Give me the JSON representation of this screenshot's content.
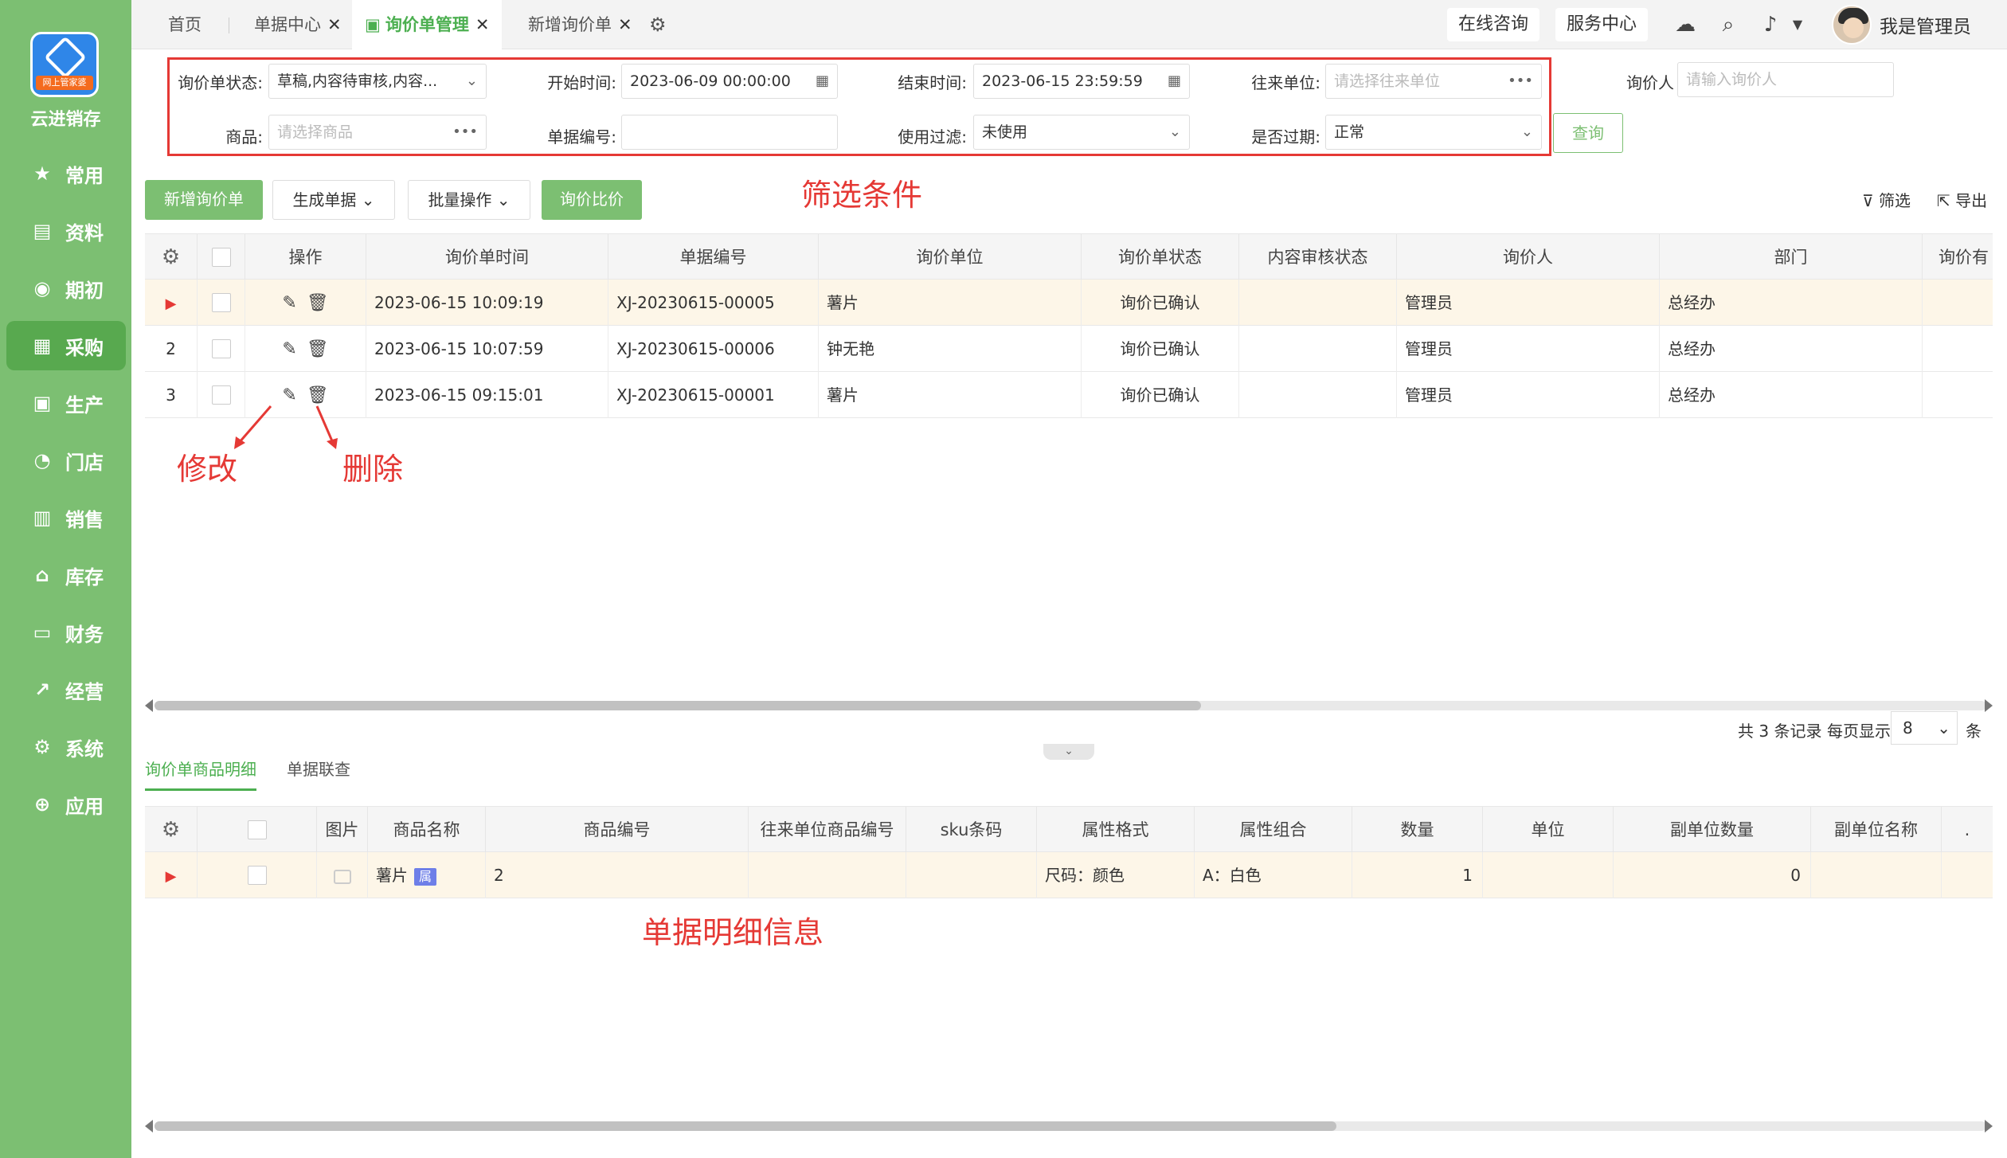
{
  "brand": {
    "name": "云进销存",
    "logo_band": "网上管家婆"
  },
  "sidebar": {
    "items": [
      {
        "label": "常用",
        "icon": "star-icon"
      },
      {
        "label": "资料",
        "icon": "doc-icon"
      },
      {
        "label": "期初",
        "icon": "target-icon"
      },
      {
        "label": "采购",
        "icon": "cart-icon",
        "active": true
      },
      {
        "label": "生产",
        "icon": "factory-icon"
      },
      {
        "label": "门店",
        "icon": "store-icon"
      },
      {
        "label": "销售",
        "icon": "chart-icon"
      },
      {
        "label": "库存",
        "icon": "warehouse-icon"
      },
      {
        "label": "财务",
        "icon": "wallet-icon"
      },
      {
        "label": "经营",
        "icon": "trend-icon"
      },
      {
        "label": "系统",
        "icon": "gear-icon"
      },
      {
        "label": "应用",
        "icon": "plus-icon"
      }
    ]
  },
  "tabs": [
    {
      "label": "首页"
    },
    {
      "label": "单据中心"
    },
    {
      "label": "询价单管理",
      "active": true
    },
    {
      "label": "新增询价单"
    }
  ],
  "header": {
    "online": "在线咨询",
    "service": "服务中心",
    "user": "我是管理员"
  },
  "filters": {
    "status_label": "询价单状态:",
    "status_value": "草稿,内容待审核,内容...",
    "start_label": "开始时间:",
    "start_value": "2023-06-09 00:00:00",
    "end_label": "结束时间:",
    "end_value": "2023-06-15 23:59:59",
    "partner_label": "往来单位:",
    "partner_placeholder": "请选择往来单位",
    "inquirer_label": "询价人",
    "inquirer_placeholder": "请输入询价人",
    "goods_label": "商品:",
    "goods_placeholder": "请选择商品",
    "docno_label": "单据编号:",
    "docno_value": "",
    "usefilter_label": "使用过滤:",
    "usefilter_value": "未使用",
    "expired_label": "是否过期:",
    "expired_value": "正常",
    "query_button": "查询"
  },
  "annotations": {
    "filter": "筛选条件",
    "edit": "修改",
    "delete": "删除",
    "detail": "单据明细信息"
  },
  "toolbar": {
    "new": "新增询价单",
    "generate": "生成单据",
    "batch": "批量操作",
    "compare": "询价比价",
    "filter": "筛选",
    "export": "导出"
  },
  "main_table": {
    "headers": [
      "操作",
      "询价单时间",
      "单据编号",
      "询价单位",
      "询价单状态",
      "内容审核状态",
      "询价人",
      "部门",
      "询价有"
    ],
    "rows": [
      {
        "idx": "",
        "time": "2023-06-15 10:09:19",
        "no": "XJ-20230615-00005",
        "unit": "薯片",
        "status": "询价已确认",
        "audit": "",
        "person": "管理员",
        "dept": "总经办"
      },
      {
        "idx": "2",
        "time": "2023-06-15 10:07:59",
        "no": "XJ-20230615-00006",
        "unit": "钟无艳",
        "status": "询价已确认",
        "audit": "",
        "person": "管理员",
        "dept": "总经办"
      },
      {
        "idx": "3",
        "time": "2023-06-15 09:15:01",
        "no": "XJ-20230615-00001",
        "unit": "薯片",
        "status": "询价已确认",
        "audit": "",
        "person": "管理员",
        "dept": "总经办"
      }
    ]
  },
  "pager": {
    "total": "共 3 条记录",
    "per_page_label": "每页显示",
    "per_page": "8",
    "unit": "条"
  },
  "subtabs": [
    {
      "label": "询价单商品明细",
      "active": true
    },
    {
      "label": "单据联查"
    }
  ],
  "detail_table": {
    "headers": [
      "图片",
      "商品名称",
      "商品编号",
      "往来单位商品编号",
      "sku条码",
      "属性格式",
      "属性组合",
      "数量",
      "单位",
      "副单位数量",
      "副单位名称",
      "."
    ],
    "rows": [
      {
        "name": "薯片",
        "badge": "属",
        "code": "2",
        "partner_code": "",
        "sku": "",
        "format": "尺码：颜色",
        "combo": "A：白色",
        "qty": "1",
        "unit": "",
        "sub_qty": "0",
        "sub_name": ""
      }
    ]
  }
}
